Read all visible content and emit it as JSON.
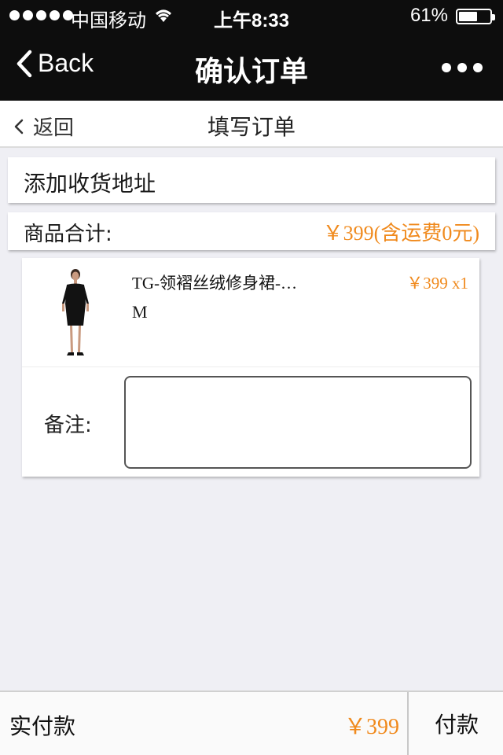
{
  "status_bar": {
    "carrier": "中国移动",
    "time": "上午8:33",
    "battery": "61%",
    "battery_level": 0.61
  },
  "nav": {
    "back_label": "Back",
    "title": "确认订单"
  },
  "sub_header": {
    "back_label": "返回",
    "title": "填写订单"
  },
  "address": {
    "label": "添加收货地址"
  },
  "summary": {
    "label": "商品合计:",
    "value": "￥399(含运费0元)"
  },
  "product": {
    "name": "TG-领褶丝绒修身裙-…",
    "price_qty": "￥399 x1",
    "size": "M"
  },
  "note": {
    "label": "备注:",
    "value": ""
  },
  "footer": {
    "label": "实付款",
    "amount": "￥399",
    "pay_button": "付款"
  },
  "colors": {
    "accent": "#f08a1d",
    "nav_bg": "#0d0d0d",
    "page_bg": "#efeff4"
  }
}
